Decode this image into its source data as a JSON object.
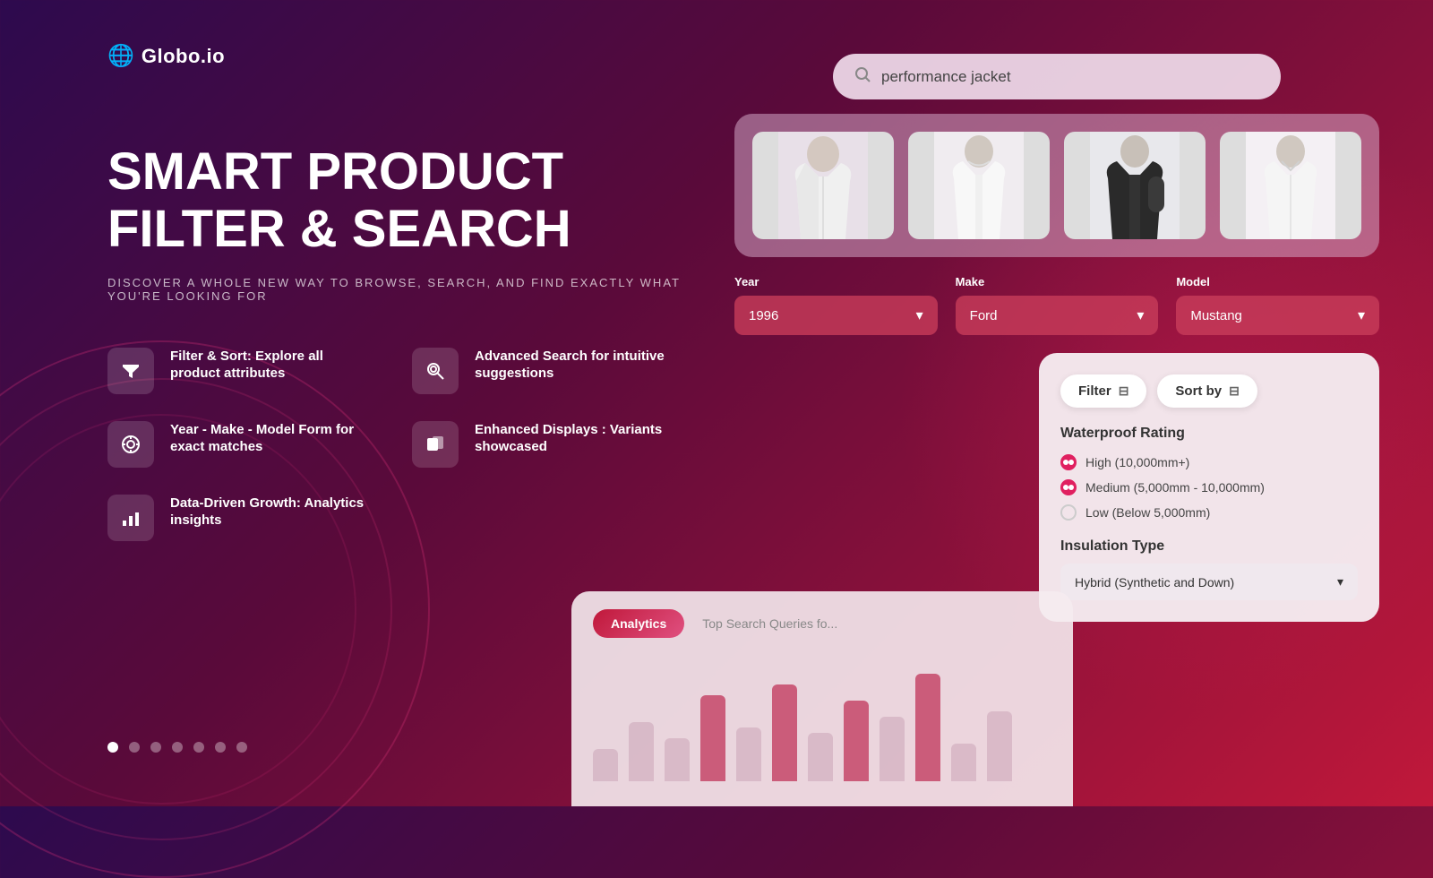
{
  "logo": {
    "icon": "🌐",
    "text": "Globo.io"
  },
  "hero": {
    "title": "SMART PRODUCT FILTER & SEARCH",
    "subtitle": "DISCOVER A WHOLE NEW WAY TO BROWSE, SEARCH, AND FIND EXACTLY WHAT YOU'RE LOOKING FOR"
  },
  "features": [
    {
      "id": "filter-sort",
      "icon": "▼",
      "title": "Filter & Sort: Explore all product attributes"
    },
    {
      "id": "advanced-search",
      "icon": "🔍",
      "title": "Advanced Search for intuitive suggestions"
    },
    {
      "id": "ymm",
      "icon": "🎯",
      "title": "Year - Make - Model Form for exact matches"
    },
    {
      "id": "variants",
      "icon": "◼",
      "title": "Enhanced Displays : Variants showcased"
    },
    {
      "id": "analytics",
      "icon": "📊",
      "title": "Data-Driven Growth: Analytics insights"
    }
  ],
  "dots": {
    "total": 7,
    "active": 0
  },
  "search": {
    "placeholder": "performance jacket",
    "value": "performance jacket"
  },
  "ymm": {
    "year_label": "Year",
    "year_value": "1996",
    "make_label": "Make",
    "make_value": "Ford",
    "model_label": "Model",
    "model_value": "Mustang"
  },
  "filter_panel": {
    "filter_btn": "Filter",
    "sort_by_btn": "Sort by",
    "waterproof_title": "Waterproof Rating",
    "options": [
      {
        "label": "High (10,000mm+)",
        "selected": true
      },
      {
        "label": "Medium (5,000mm - 10,000mm)",
        "selected": true
      },
      {
        "label": "Low (Below 5,000mm)",
        "selected": false
      }
    ],
    "insulation_title": "Insulation Type",
    "insulation_value": "Hybrid (Synthetic and Down)"
  },
  "analytics": {
    "tab_label": "Analytics",
    "sub_label": "Top Search Queries fo...",
    "bars": [
      30,
      55,
      40,
      80,
      50,
      90,
      45,
      75,
      60,
      100,
      35,
      65
    ]
  },
  "products": [
    {
      "id": 1,
      "emoji": "🧥"
    },
    {
      "id": 2,
      "emoji": "🧥"
    },
    {
      "id": 3,
      "emoji": "🧥"
    },
    {
      "id": 4,
      "emoji": "🧥"
    }
  ]
}
